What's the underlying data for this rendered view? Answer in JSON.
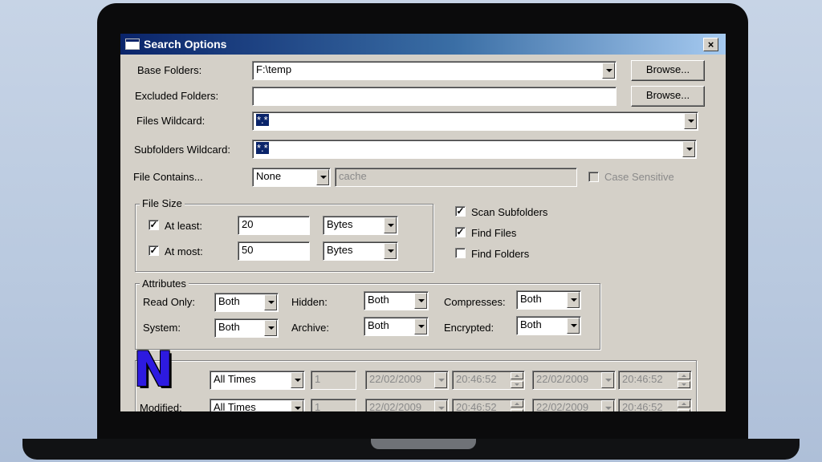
{
  "window": {
    "title": "Search Options",
    "close_label": "×"
  },
  "fields": {
    "base_folders": {
      "label": "Base Folders:",
      "value": "F:\\temp",
      "browse_label": "Browse..."
    },
    "excluded_folders": {
      "label": "Excluded Folders:",
      "value": "",
      "browse_label": "Browse..."
    },
    "files_wildcard": {
      "label": "Files Wildcard:",
      "value": "*.*"
    },
    "subfolders_wildcard": {
      "label": "Subfolders Wildcard:",
      "value": "*.*"
    },
    "file_contains": {
      "label": "File Contains...",
      "mode": "None",
      "text": "cache",
      "case_sensitive_label": "Case Sensitive"
    }
  },
  "file_size": {
    "legend": "File Size",
    "at_least": {
      "label": "At least:",
      "value": "20",
      "unit": "Bytes",
      "checked": true
    },
    "at_most": {
      "label": "At most:",
      "value": "50",
      "unit": "Bytes",
      "checked": true
    }
  },
  "options": {
    "scan_subfolders": {
      "label": "Scan Subfolders",
      "checked": true
    },
    "find_files": {
      "label": "Find Files",
      "checked": true
    },
    "find_folders": {
      "label": "Find Folders",
      "checked": false
    }
  },
  "attributes": {
    "legend": "Attributes",
    "read_only": {
      "label": "Read Only:",
      "value": "Both"
    },
    "hidden": {
      "label": "Hidden:",
      "value": "Both"
    },
    "compresses": {
      "label": "Compresses:",
      "value": "Both"
    },
    "system": {
      "label": "System:",
      "value": "Both"
    },
    "archive": {
      "label": "Archive:",
      "value": "Both"
    },
    "encrypted": {
      "label": "Encrypted:",
      "value": "Both"
    }
  },
  "dates": {
    "row1": {
      "label": "",
      "mode": "All Times",
      "count": "1",
      "from_date": "22/02/2009",
      "from_time": "20:46:52",
      "to_date": "22/02/2009",
      "to_time": "20:46:52"
    },
    "row2": {
      "label": "Modified:",
      "mode": "All Times",
      "count": "1",
      "from_date": "22/02/2009",
      "from_time": "20:46:52",
      "to_date": "22/02/2009",
      "to_time": "20:46:52"
    }
  },
  "watermark": {
    "letter": "N"
  },
  "colors": {
    "title_start": "#0a246a",
    "title_end": "#a6caf0",
    "selection": "#0a246a",
    "logo": "#2d1ae0"
  }
}
